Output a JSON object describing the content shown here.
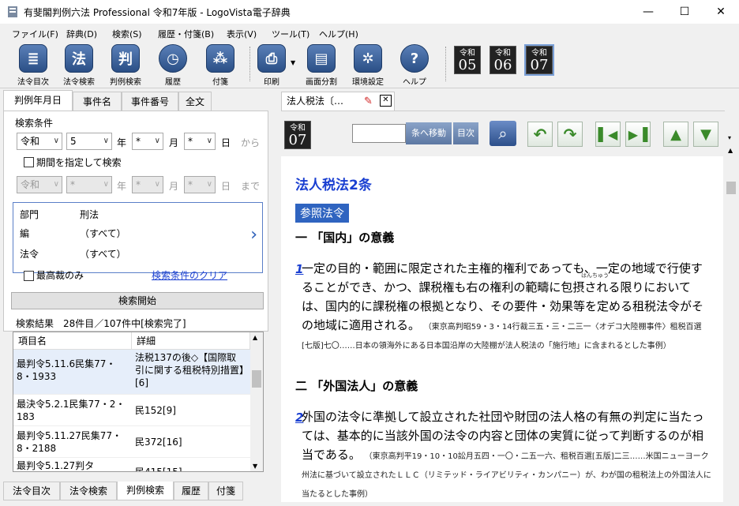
{
  "window": {
    "title": "有斐閣判例六法 Professional 令和7年版 - LogoVista電子辞典",
    "minimize": "—",
    "maximize": "☐",
    "close": "✕"
  },
  "menu": [
    "ファイル(F)",
    "辞典(D)",
    "検索(S)",
    "履歴・付箋(B)",
    "表示(V)",
    "ツール(T)",
    "ヘルプ(H)"
  ],
  "toolbar": {
    "buttons": [
      {
        "label": "法令目次",
        "icon": "book-list-icon",
        "glyph": "≣"
      },
      {
        "label": "法令検索",
        "icon": "law-search-icon",
        "glyph": "法"
      },
      {
        "label": "判例検索",
        "icon": "case-search-icon",
        "glyph": "判"
      },
      {
        "label": "履歴",
        "icon": "clock-icon",
        "glyph": "◷"
      },
      {
        "label": "付箋",
        "icon": "sticky-note-icon",
        "glyph": "⁂"
      },
      {
        "label": "印刷",
        "icon": "printer-icon",
        "glyph": "⎙"
      },
      {
        "label": "画面分割",
        "icon": "split-screen-icon",
        "glyph": "▤"
      },
      {
        "label": "環境設定",
        "icon": "gear-icon",
        "glyph": "✲"
      },
      {
        "label": "ヘルプ",
        "icon": "help-icon",
        "glyph": "?"
      }
    ],
    "years": [
      {
        "era": "令和",
        "num": "05"
      },
      {
        "era": "令和",
        "num": "06"
      },
      {
        "era": "令和",
        "num": "07"
      }
    ]
  },
  "left": {
    "tabs": [
      "判例年月日",
      "事件名",
      "事件番号",
      "全文"
    ],
    "search_conditions": "検索条件",
    "era": "令和",
    "year": "5",
    "month": "*",
    "day": "*",
    "year_unit": "年",
    "month_unit": "月",
    "day_unit": "日",
    "from": "から",
    "to": "まで",
    "period_check": "期間を指定して検索",
    "conditions": [
      {
        "key": "部門",
        "value": "刑法"
      },
      {
        "key": "編",
        "value": "（すべて）"
      },
      {
        "key": "法令",
        "value": "（すべて）"
      }
    ],
    "supreme_only": "最高裁のみ",
    "clear_link": "検索条件のクリア",
    "start_button": "検索開始",
    "results_caption": "検索結果　28件目／107件中[検索完了]",
    "col_item": "項目名",
    "col_detail": "詳細",
    "rows": [
      {
        "item": "最判令5.11.6民集77・8・1933",
        "detail": "法税137の後◇【国際取引に関する租税特別措置】[6]"
      },
      {
        "item": "最決令5.2.1民集77・2・183",
        "detail": "民152[9]"
      },
      {
        "item": "最判令5.11.27民集77・8・2188",
        "detail": "民372[16]"
      },
      {
        "item": "最判令5.1.27判タ",
        "detail": "民415[15]"
      }
    ],
    "bottom_tabs": [
      "法令目次",
      "法令検索",
      "判例検索",
      "履歴",
      "付箋"
    ]
  },
  "right": {
    "tab_title": "法人税法〔…",
    "year_badge": {
      "era": "令和",
      "num": "07"
    },
    "jump_button": "条へ移動",
    "toc_button": "目次",
    "article_title": "法人税法2条",
    "ref_badge": "参照法令",
    "sec1": "一 「国内」の意義",
    "p1_num": "1",
    "p1": "一定の目的・範囲に限定された主権的権利であっても、一定の地域で行使することができ、かつ、課税権も右の権利の範疇に包摂される限りにおいては、国内的に課税権の根拠となり、その要件・効果等を定める租税法令がその地域に適用される。",
    "p1_ruby": "はんちゅう",
    "p1_note": "（東京高判昭59・3・14行裁三五・三・二三一〈オデコ大陸棚事件〉租税百選[七版]七〇……日本の領海外にある日本国沿岸の大陸棚が法人税法の「施行地」に含まれるとした事例）",
    "sec2": "二 「外国法人」の意義",
    "p2_num": "2",
    "p2": "外国の法令に準拠して設立された社団や財団の法人格の有無の判定に当たっては、基本的に当該外国の法令の内容と団体の実質に従って判断するのが相当である。",
    "p2_note": "（東京高判平19・10・10訟月五四・一〇・二五一六、租税百選[五版]二三……米国ニューヨーク州法に基づいて設立されたＬＬＣ（リミテッド・ライアビリティ・カンパニー）が、わが国の租税法上の外国法人に当たるとした事例）"
  }
}
